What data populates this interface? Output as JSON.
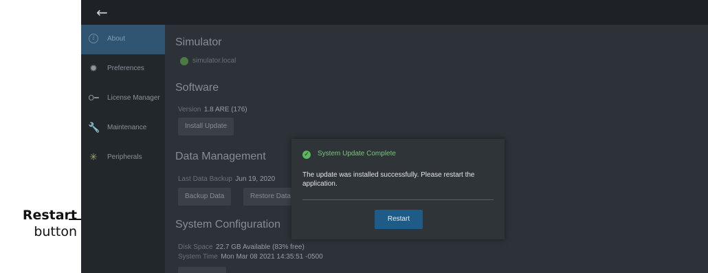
{
  "callout": {
    "title": "Restart",
    "subtitle": "button"
  },
  "sidebar": {
    "items": [
      {
        "label": "About",
        "icon": "info-icon",
        "active": true
      },
      {
        "label": "Preferences",
        "icon": "gear-icon"
      },
      {
        "label": "License Manager",
        "icon": "key-icon"
      },
      {
        "label": "Maintenance",
        "icon": "wrench-icon"
      },
      {
        "label": "Peripherals",
        "icon": "peripherals-icon"
      }
    ]
  },
  "simulator": {
    "title": "Simulator",
    "host": "simulator.local",
    "status_color": "#4b7a45"
  },
  "software": {
    "title": "Software",
    "version_label": "Version",
    "version_value": "1.8 ARE (176)",
    "install_button": "Install Update"
  },
  "data_management": {
    "title": "Data Management",
    "last_backup_label": "Last Data Backup",
    "last_backup_value": "Jun 19, 2020",
    "backup_button": "Backup Data",
    "restore_button": "Restore Data"
  },
  "system_configuration": {
    "title": "System Configuration",
    "disk_label": "Disk Space",
    "disk_value": "22.7 GB Available (83% free)",
    "time_label": "System Time",
    "time_value": "Mon Mar 08 2021 14:35:51 -0500"
  },
  "dialog": {
    "title": "System Update Complete",
    "message": "The update was installed successfully. Please restart the application.",
    "button": "Restart",
    "title_color": "#79c77a",
    "button_color": "#1f5b87"
  }
}
